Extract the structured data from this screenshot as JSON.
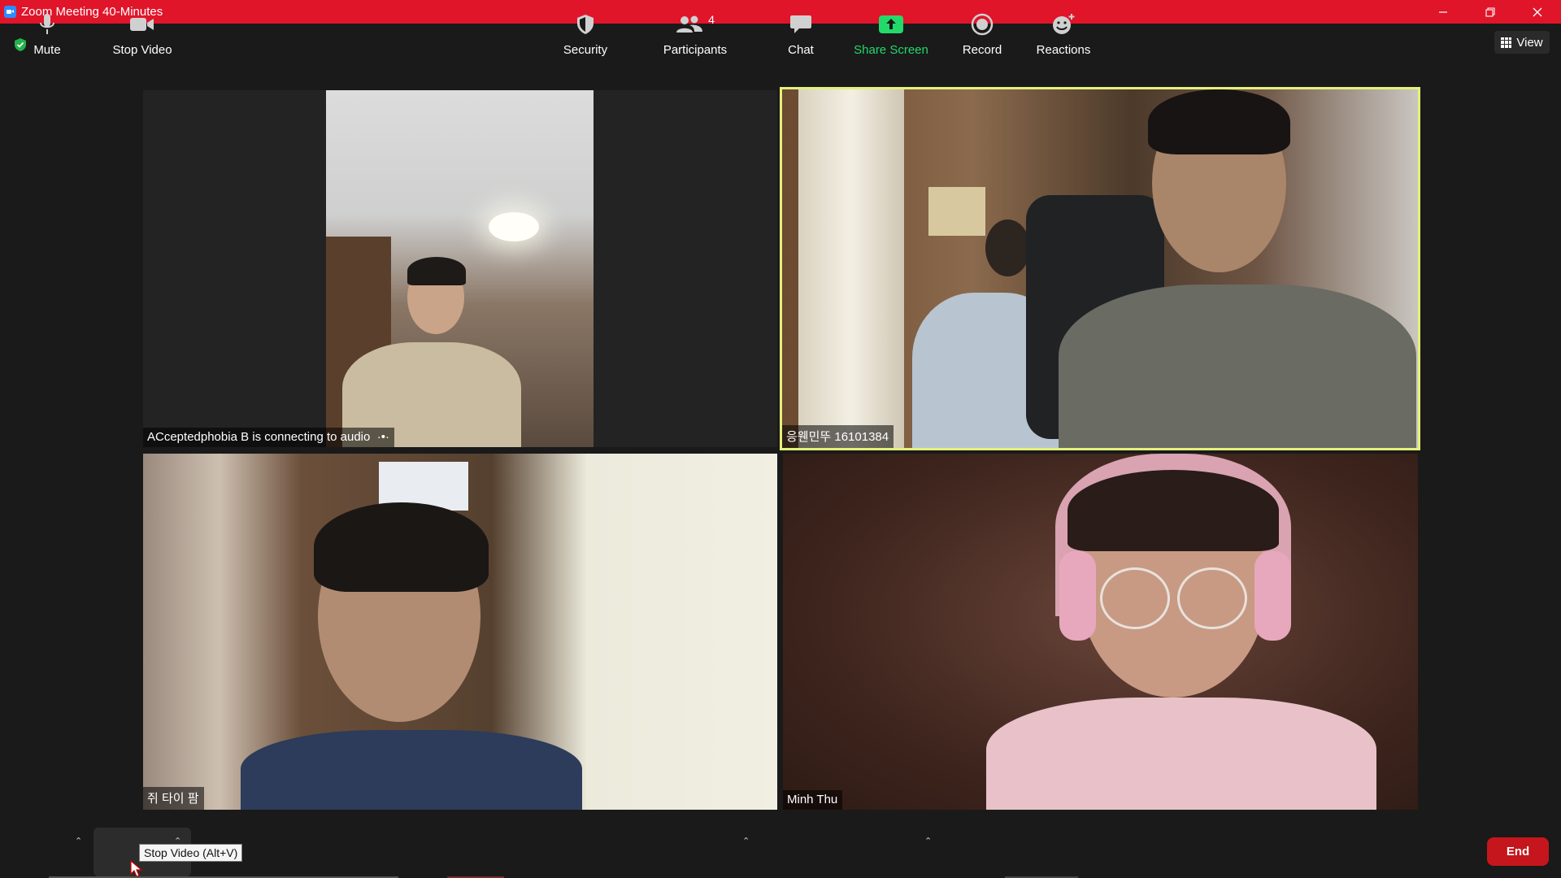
{
  "window": {
    "title": "Zoom Meeting 40-Minutes",
    "controls": [
      "minimize",
      "restore",
      "close"
    ]
  },
  "header": {
    "secure_icon": "shield-check-icon",
    "view_label": "View"
  },
  "participants_tiles": [
    {
      "name": "ACceptedphobia B is connecting to audio",
      "status_icon": "connecting-dots-icon"
    },
    {
      "name": "응웬민뚜 16101384",
      "active_speaker": true
    },
    {
      "name": "쥐 타이 팜"
    },
    {
      "name": "Minh Thu"
    }
  ],
  "toolbar": {
    "mute_label": "Mute",
    "video_label": "Stop Video",
    "video_tooltip": "Stop Video (Alt+V)",
    "security_label": "Security",
    "participants_label": "Participants",
    "participants_count": "4",
    "chat_label": "Chat",
    "share_label": "Share Screen",
    "record_label": "Record",
    "reactions_label": "Reactions",
    "end_label": "End"
  },
  "colors": {
    "titlebar": "#e0152a",
    "active_speaker_border": "#e5f07a",
    "share_green": "#23d96a",
    "end_red": "#c4161c"
  }
}
